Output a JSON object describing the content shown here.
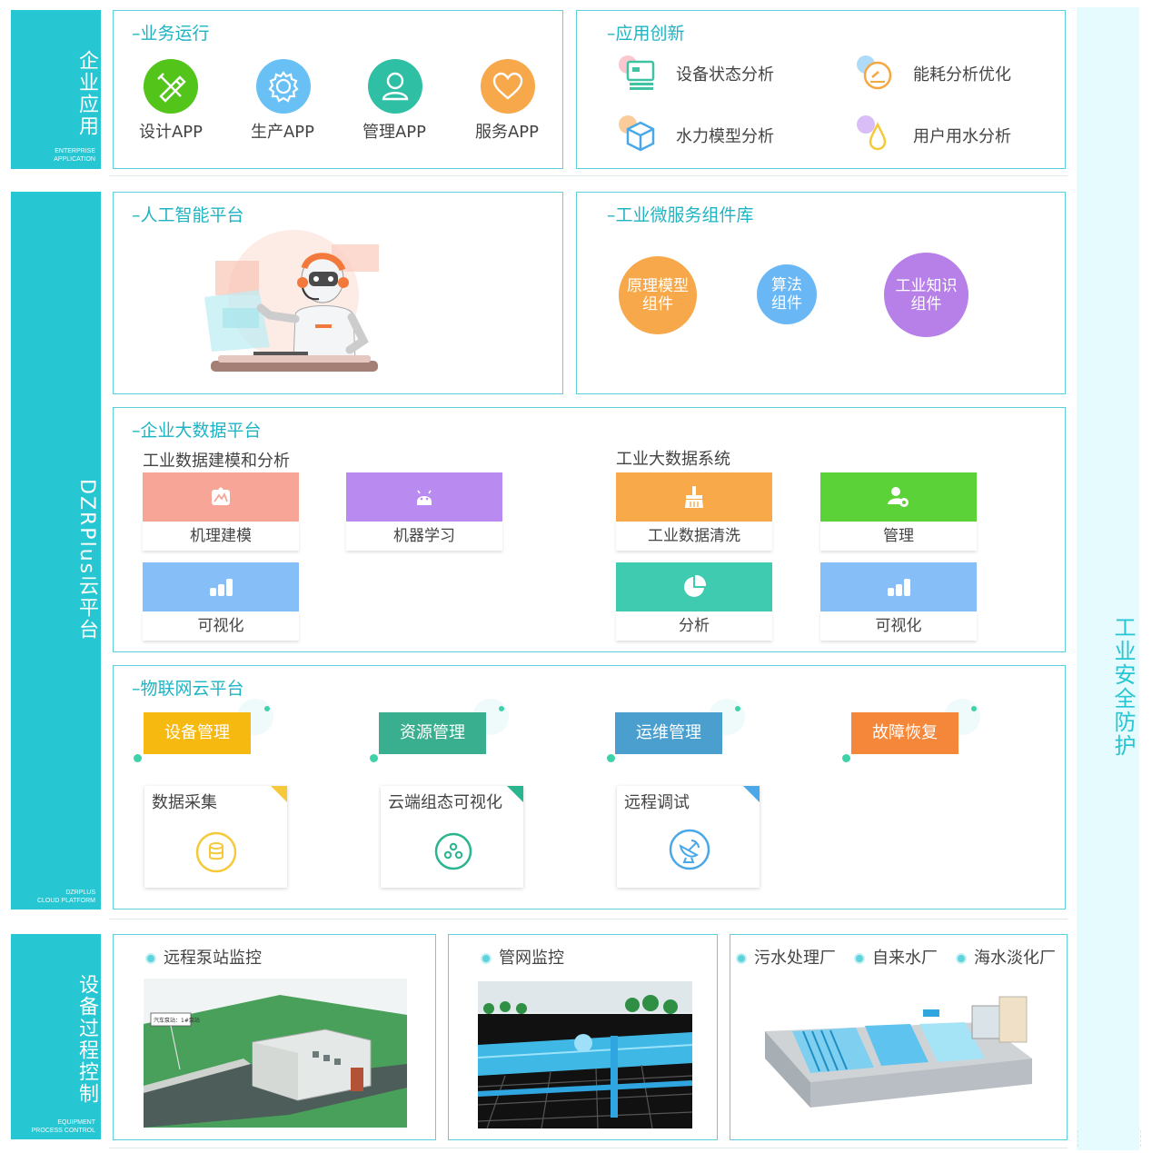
{
  "left_sidebar": {
    "enterprise": {
      "title": "企业应用",
      "caption": [
        "ENTERPRISE",
        "APPLICATION"
      ]
    },
    "cloud": {
      "title": "DZRPlus云平台",
      "caption": [
        "DZRPLUS",
        "CLOUD PLATFORM"
      ]
    },
    "equipment": {
      "title": "设备过程控制",
      "caption": [
        "EQUIPMENT",
        "PROCESS CONTROL"
      ]
    }
  },
  "right_sidebar": {
    "title": "工业安全防护"
  },
  "business": {
    "title": "业务运行",
    "apps": [
      {
        "label": "设计APP",
        "icon": "pencil-ruler-icon",
        "color": "#52c41a"
      },
      {
        "label": "生产APP",
        "icon": "gear-icon",
        "color": "#69c0f5"
      },
      {
        "label": "管理APP",
        "icon": "user-icon",
        "color": "#2ebfa5"
      },
      {
        "label": "服务APP",
        "icon": "heart-icon",
        "color": "#f7a84a"
      }
    ]
  },
  "innovation": {
    "title": "应用创新",
    "items": [
      {
        "label": "设备状态分析",
        "icon": "device-status-icon"
      },
      {
        "label": "能耗分析优化",
        "icon": "energy-gauge-icon"
      },
      {
        "label": "水力模型分析",
        "icon": "hydraulic-cube-icon"
      },
      {
        "label": "用户用水分析",
        "icon": "water-drop-icon"
      }
    ]
  },
  "ai_platform": {
    "title": "人工智能平台",
    "illustration": "robot-operator-icon"
  },
  "microservice": {
    "title": "工业微服务组件库",
    "components": [
      {
        "line1": "原理模型",
        "line2": "组件",
        "color": "#f7a84a"
      },
      {
        "line1": "算法",
        "line2": "组件",
        "color": "#69b8f5"
      },
      {
        "line1": "工业知识",
        "line2": "组件",
        "color": "#b77fe8"
      }
    ]
  },
  "bigdata": {
    "title": "企业大数据平台",
    "left_subtitle": "工业数据建模和分析",
    "right_subtitle": "工业大数据系统",
    "tiles": [
      {
        "label": "机理建模",
        "color": "#f6a596",
        "icon": "mechanism-icon"
      },
      {
        "label": "机器学习",
        "color": "#b98af0",
        "icon": "android-icon"
      },
      {
        "label": "可视化",
        "color": "#86bff7",
        "icon": "bar-chart-icon"
      },
      {
        "label": "工业数据清洗",
        "color": "#f8aa4b",
        "icon": "broom-icon"
      },
      {
        "label": "管理",
        "color": "#5bd237",
        "icon": "user-gear-icon"
      },
      {
        "label": "分析",
        "color": "#3fcbb0",
        "icon": "pie-chart-icon"
      },
      {
        "label": "可视化",
        "color": "#86bff7",
        "icon": "bar-chart-icon"
      }
    ]
  },
  "iot": {
    "title": "物联网云平台",
    "tags": [
      {
        "label": "设备管理",
        "color": "#f5b90f"
      },
      {
        "label": "资源管理",
        "color": "#3aaf8f"
      },
      {
        "label": "运维管理",
        "color": "#4a9fcf"
      },
      {
        "label": "故障恢复",
        "color": "#f5873a"
      }
    ],
    "cards": [
      {
        "label": "数据采集",
        "icon": "coins-icon",
        "color": "#f5c93a"
      },
      {
        "label": "云端组态可视化",
        "icon": "nodes-icon",
        "color": "#2bb58f"
      },
      {
        "label": "远程调试",
        "icon": "satellite-icon",
        "color": "#4aa8e8"
      }
    ]
  },
  "equipment": {
    "pump": {
      "label": "远程泵站监控",
      "sign": "汽车泵站：1#泵站"
    },
    "network": {
      "label": "管网监控"
    },
    "plants": [
      "污水处理厂",
      "自来水厂",
      "海水淡化厂"
    ]
  },
  "colors": {
    "accent": "#26c6d3",
    "light_panel": "#e6fbfd"
  }
}
